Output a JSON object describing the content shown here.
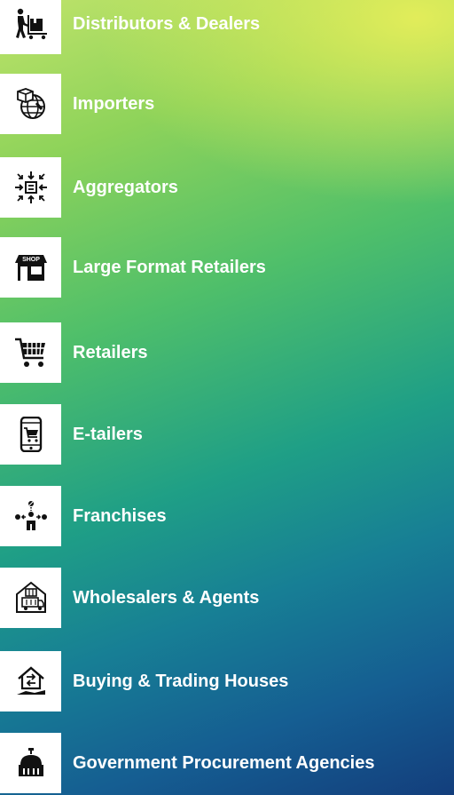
{
  "items": [
    {
      "label": "Distributors & Dealers",
      "icon": "person-pushing-cart-icon"
    },
    {
      "label": "Importers",
      "icon": "globe-package-icon"
    },
    {
      "label": "Aggregators",
      "icon": "arrows-converge-icon"
    },
    {
      "label": "Large Format Retailers",
      "icon": "shop-storefront-icon"
    },
    {
      "label": "Retailers",
      "icon": "shopping-cart-icon"
    },
    {
      "label": "E-tailers",
      "icon": "mobile-cart-icon"
    },
    {
      "label": "Franchises",
      "icon": "network-hub-icon"
    },
    {
      "label": "Wholesalers & Agents",
      "icon": "warehouse-truck-icon"
    },
    {
      "label": "Buying & Trading Houses",
      "icon": "house-exchange-icon"
    },
    {
      "label": "Government Procurement Agencies",
      "icon": "government-dome-icon"
    }
  ],
  "icon_text": {
    "shop_sign": "SHOP"
  },
  "colors": {
    "label": "#ffffff",
    "icon_box": "#ffffff",
    "icon": "#111111"
  }
}
